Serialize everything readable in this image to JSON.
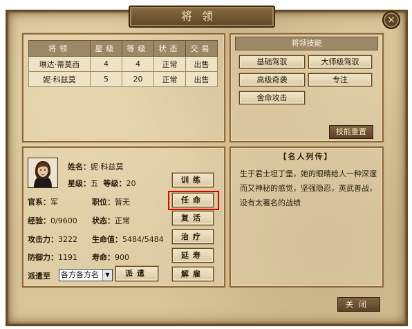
{
  "window": {
    "title": "将领",
    "close_icon": "×"
  },
  "generals_table": {
    "headers": [
      "将领",
      "星级",
      "等级",
      "状态",
      "交易"
    ],
    "rows": [
      [
        "琳达·蒂莫西",
        "4",
        "4",
        "正常",
        "出售"
      ],
      [
        "妮·科兹莫",
        "5",
        "20",
        "正常",
        "出售"
      ]
    ]
  },
  "skills": {
    "title": "将领技能",
    "items": [
      "基础驾驭",
      "大师级驾驭",
      "高级奇袭",
      "专注",
      "舍命攻击"
    ],
    "reset_label": "技能重置"
  },
  "bio": {
    "title": "【名人列传】",
    "text": "生于君士坦丁堡，她的眼睛给人一种深邃而又神秘的感觉，坚强隐忍，英武善战，没有太著名的战绩"
  },
  "general": {
    "name_label": "姓名：",
    "name": "妮·科兹莫",
    "star_label": "星级：",
    "star": "五",
    "level_label": "等级：",
    "level": "20",
    "official_label": "官系：",
    "official": "军",
    "post_label": "职位：",
    "post": "暂无",
    "exp_label": "经验：",
    "exp": "0/9600",
    "status_label": "状态：",
    "status": "正常",
    "attack_label": "攻击力：",
    "attack": "3222",
    "hp_label": "生命值：",
    "hp": "5484/5484",
    "defense_label": "防御力：",
    "defense": "1191",
    "life_label": "寿命：",
    "life": "900",
    "dispatch_label": "派遣至",
    "dispatch_value": "各方各方名",
    "dispatch_button": "派遣"
  },
  "actions": [
    "训练",
    "任命",
    "复活",
    "治疗",
    "延寿",
    "解雇"
  ],
  "footer": {
    "close_label": "关闭"
  },
  "colors": {
    "parchment": "#d9c59a",
    "frame": "#6b4a22",
    "highlight": "#e00000"
  }
}
